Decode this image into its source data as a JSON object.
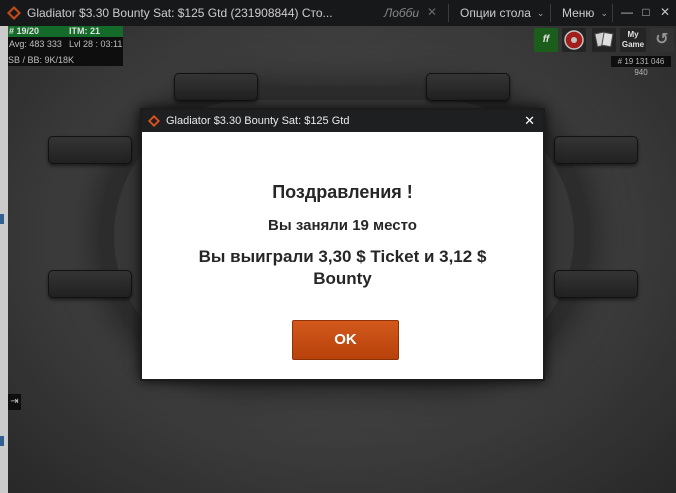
{
  "window": {
    "title": "Gladiator $3.30 Bounty Sat: $125 Gtd (231908844) Сто...",
    "lobby_label": "Лобби",
    "table_options_label": "Опции стола",
    "menu_label": "Меню"
  },
  "info": {
    "rank": "# 19/20",
    "itm": "ITM: 21",
    "avg": "Avg: 483 333",
    "level": "Lvl 28 : 03:11",
    "blinds": "SB / BB: 9K/18K"
  },
  "right_icons": {
    "ff_label": "ff",
    "my_game_label": "My Game",
    "hand_id": "# 19 131 046 940"
  },
  "dialog": {
    "title": "Gladiator $3.30 Bounty Sat: $125 Gtd",
    "heading": "Поздравления !",
    "place_text": "Вы заняли 19 место",
    "won_text": "Вы выиграли 3,30 $ Ticket и 3,12 $ Bounty",
    "ok_label": "OK"
  },
  "colors": {
    "brand_orange": "#d2581c",
    "itm_green": "#177a2f"
  }
}
